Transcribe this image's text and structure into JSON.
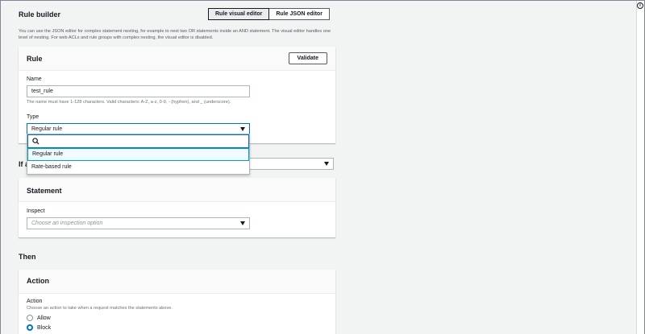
{
  "rule_builder": {
    "title": "Rule builder",
    "tabs": [
      "Rule visual editor",
      "Rule JSON editor"
    ],
    "description": "You can use the JSON editor for complex statement nesting, for example to nest two OR statements inside an AND statement. The visual editor handles one level of nesting. For web ACLs and rule groups with complex nesting, the visual editor is disabled."
  },
  "rule": {
    "title": "Rule",
    "validate_label": "Validate",
    "name_label": "Name",
    "name_value": "test_rule",
    "name_hint": "The name must have 1-128 characters. Valid characters: A-Z, a-z, 0-9, - (hyphen), and _ (underscore).",
    "type_label": "Type",
    "type_value": "Regular rule",
    "type_options": [
      "Regular rule",
      "Rate-based rule"
    ],
    "search_value": ""
  },
  "if_section": {
    "title": "If a"
  },
  "statement": {
    "title": "Statement",
    "inspect_label": "Inspect",
    "inspect_placeholder": "Choose an inspection option"
  },
  "then_section": {
    "title": "Then"
  },
  "action": {
    "title": "Action",
    "action_label": "Action",
    "action_hint": "Choose an action to take when a request matches the statements above.",
    "options": [
      "Allow",
      "Block"
    ],
    "selected": "Block"
  },
  "icons": {
    "info": "info-icon",
    "search": "search-icon",
    "dropdown": "caret-down-icon"
  },
  "colors": {
    "accent": "#0073bb",
    "page_bg": "#f2f3f3"
  }
}
